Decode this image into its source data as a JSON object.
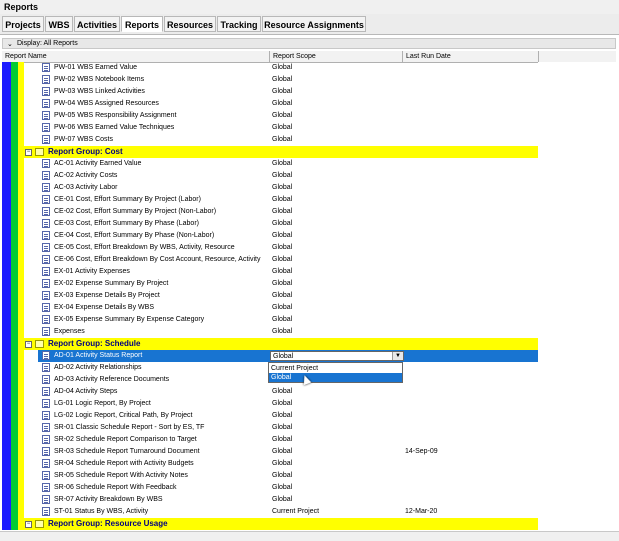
{
  "window_title": "Reports",
  "tabs": [
    "Projects",
    "WBS",
    "Activities",
    "Reports",
    "Resources",
    "Tracking",
    "Resource Assignments"
  ],
  "active_tab": "Reports",
  "display_bar": {
    "label": "Display: All Reports"
  },
  "columns": {
    "name": "Report Name",
    "scope": "Report Scope",
    "date": "Last Run Date"
  },
  "colors": {
    "stripe1": "#1a1aff",
    "stripe2": "#00cc33",
    "stripe3": "#ffff00",
    "group_band": "#ffff00",
    "selected": "#1874d1"
  },
  "rows": [
    {
      "kind": "report",
      "name": "PW-01 WBS Earned Value",
      "scope": "Global",
      "date": ""
    },
    {
      "kind": "report",
      "name": "PW-02 WBS Notebook Items",
      "scope": "Global",
      "date": ""
    },
    {
      "kind": "report",
      "name": "PW-03 WBS Linked Activities",
      "scope": "Global",
      "date": ""
    },
    {
      "kind": "report",
      "name": "PW-04 WBS Assigned Resources",
      "scope": "Global",
      "date": ""
    },
    {
      "kind": "report",
      "name": "PW-05 WBS Responsibility Assignment",
      "scope": "Global",
      "date": ""
    },
    {
      "kind": "report",
      "name": "PW-06 WBS Earned Value Techniques",
      "scope": "Global",
      "date": ""
    },
    {
      "kind": "report",
      "name": "PW-07 WBS Costs",
      "scope": "Global",
      "date": ""
    },
    {
      "kind": "group",
      "name": "Report Group: Cost"
    },
    {
      "kind": "report",
      "name": "AC-01 Activity Earned Value",
      "scope": "Global",
      "date": ""
    },
    {
      "kind": "report",
      "name": "AC-02 Activity Costs",
      "scope": "Global",
      "date": ""
    },
    {
      "kind": "report",
      "name": "AC-03 Activity Labor",
      "scope": "Global",
      "date": ""
    },
    {
      "kind": "report",
      "name": "CE-01 Cost, Effort Summary By Project (Labor)",
      "scope": "Global",
      "date": ""
    },
    {
      "kind": "report",
      "name": "CE-02 Cost, Effort Summary By Project (Non-Labor)",
      "scope": "Global",
      "date": ""
    },
    {
      "kind": "report",
      "name": "CE-03 Cost, Effort Summary By Phase (Labor)",
      "scope": "Global",
      "date": ""
    },
    {
      "kind": "report",
      "name": "CE-04 Cost, Effort Summary By Phase (Non-Labor)",
      "scope": "Global",
      "date": ""
    },
    {
      "kind": "report",
      "name": "CE-05 Cost, Effort Breakdown By WBS, Activity, Resource",
      "scope": "Global",
      "date": ""
    },
    {
      "kind": "report",
      "name": "CE-06 Cost, Effort Breakdown By Cost Account, Resource, Activity",
      "scope": "Global",
      "date": ""
    },
    {
      "kind": "report",
      "name": "EX-01 Activity Expenses",
      "scope": "Global",
      "date": ""
    },
    {
      "kind": "report",
      "name": "EX-02 Expense Summary By Project",
      "scope": "Global",
      "date": ""
    },
    {
      "kind": "report",
      "name": "EX-03 Expense Details By Project",
      "scope": "Global",
      "date": ""
    },
    {
      "kind": "report",
      "name": "EX-04 Expense Details By WBS",
      "scope": "Global",
      "date": ""
    },
    {
      "kind": "report",
      "name": "EX-05 Expense Summary By Expense Category",
      "scope": "Global",
      "date": ""
    },
    {
      "kind": "report",
      "name": "Expenses",
      "scope": "Global",
      "date": ""
    },
    {
      "kind": "group",
      "name": "Report Group: Schedule"
    },
    {
      "kind": "selected",
      "name": "AD-01 Activity Status Report",
      "scope": "Global",
      "date": ""
    },
    {
      "kind": "report",
      "name": "AD-02 Activity Relationships",
      "scope": "",
      "date": ""
    },
    {
      "kind": "report",
      "name": "AD-03 Activity Reference Documents",
      "scope": "",
      "date": ""
    },
    {
      "kind": "report",
      "name": "AD-04 Activity Steps",
      "scope": "Global",
      "date": ""
    },
    {
      "kind": "report",
      "name": "LG-01 Logic Report, By Project",
      "scope": "Global",
      "date": ""
    },
    {
      "kind": "report",
      "name": "LG-02 Logic Report, Critical Path, By Project",
      "scope": "Global",
      "date": ""
    },
    {
      "kind": "report",
      "name": "SR-01 Classic Schedule Report - Sort by ES, TF",
      "scope": "Global",
      "date": ""
    },
    {
      "kind": "report",
      "name": "SR-02 Schedule Report Comparison to Target",
      "scope": "Global",
      "date": ""
    },
    {
      "kind": "report",
      "name": "SR-03 Schedule Report Turnaround Document",
      "scope": "Global",
      "date": "14-Sep-09"
    },
    {
      "kind": "report",
      "name": "SR-04 Schedule Report with Activity Budgets",
      "scope": "Global",
      "date": ""
    },
    {
      "kind": "report",
      "name": "SR-05 Schedule Report With Activity Notes",
      "scope": "Global",
      "date": ""
    },
    {
      "kind": "report",
      "name": "SR-06 Schedule Report With Feedback",
      "scope": "Global",
      "date": ""
    },
    {
      "kind": "report",
      "name": "SR-07 Activity Breakdown By WBS",
      "scope": "Global",
      "date": ""
    },
    {
      "kind": "report",
      "name": "ST-01 Status By WBS, Activity",
      "scope": "Current Project",
      "date": "12-Mar-20"
    },
    {
      "kind": "group",
      "name": "Report Group: Resource Usage"
    }
  ],
  "dropdown": {
    "value": "Global",
    "options": [
      "Current Project",
      "Global"
    ],
    "highlighted": "Global"
  }
}
